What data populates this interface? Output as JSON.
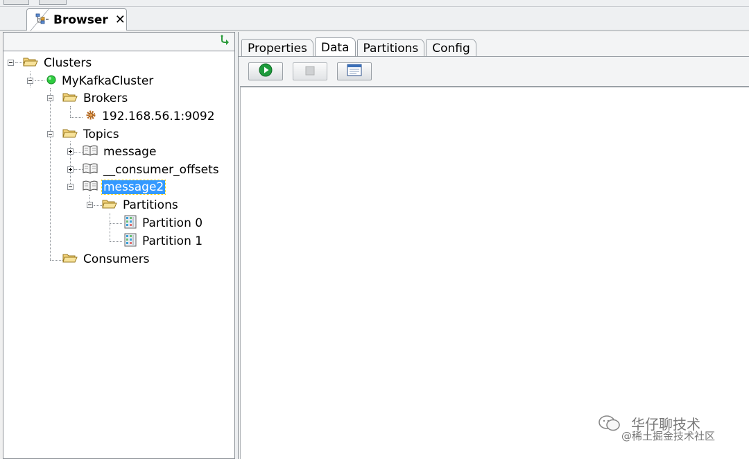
{
  "view_tab": {
    "title": "Browser",
    "close": "✕",
    "icon": "hierarchy-icon"
  },
  "left_toolbar": {
    "collapse_icon": "arrow-collapse-icon"
  },
  "tree": {
    "clusters": "Clusters",
    "cluster": "MyKafkaCluster",
    "brokers": "Brokers",
    "broker_address": "192.168.56.1:9092",
    "topics": "Topics",
    "topic_1": "message",
    "topic_2": "__consumer_offsets",
    "topic_3": "message2",
    "partitions": "Partitions",
    "partition_0": "Partition 0",
    "partition_1": "Partition 1",
    "consumers": "Consumers",
    "selected": "message2"
  },
  "detail_tabs": [
    "Properties",
    "Data",
    "Partitions",
    "Config"
  ],
  "active_tab": "Data",
  "toolbar_buttons": [
    {
      "name": "start",
      "icon": "play-icon",
      "enabled": true
    },
    {
      "name": "stop",
      "icon": "stop-icon",
      "enabled": false
    },
    {
      "name": "view",
      "icon": "window-icon",
      "enabled": true
    }
  ],
  "watermark": {
    "line1": "华仔聊技术",
    "line2": "@稀土掘金技术社区"
  },
  "colors": {
    "selection": "#3399ff",
    "cluster_status": "#2ecc40",
    "folder": "#f0c040",
    "play": "#1e9b3c"
  }
}
